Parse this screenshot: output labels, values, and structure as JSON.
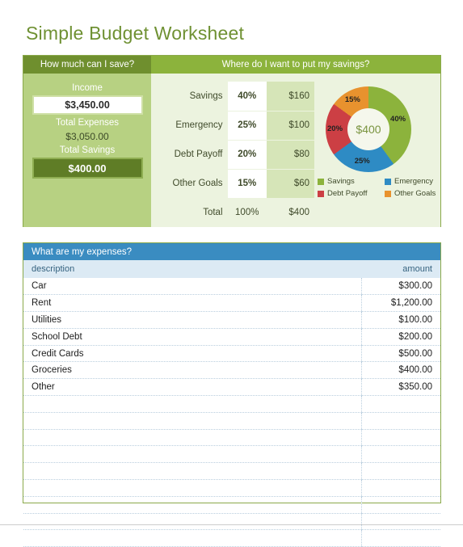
{
  "page_title": "Simple Budget Worksheet",
  "colors": {
    "title_green": "#6f9133",
    "header_dark_green": "#6f8f2e",
    "header_light_green": "#8cb33c",
    "panel_green": "#b7d182",
    "panel_pale_green": "#ecf3df",
    "savings_box_green": "#5f7d26",
    "expenses_blue": "#3a8cc1",
    "column_header_blue": "#dceaf4"
  },
  "savings": {
    "left_header": "How much can I save?",
    "right_header": "Where do I want to put my savings?",
    "income_label": "Income",
    "income_value": "$3,450.00",
    "total_expenses_label": "Total Expenses",
    "total_expenses_value": "$3,050.00",
    "total_savings_label": "Total Savings",
    "total_savings_value": "$400.00",
    "allocation_rows": [
      {
        "name": "Savings",
        "percent": "40%",
        "amount": "$160"
      },
      {
        "name": "Emergency",
        "percent": "25%",
        "amount": "$100"
      },
      {
        "name": "Debt Payoff",
        "percent": "20%",
        "amount": "$80"
      },
      {
        "name": "Other Goals",
        "percent": "15%",
        "amount": "$60"
      }
    ],
    "total_row": {
      "name": "Total",
      "percent": "100%",
      "amount": "$400"
    }
  },
  "chart_data": {
    "type": "pie",
    "title": "Where do I want to put my savings?",
    "center_label": "$400",
    "legend_position": "bottom",
    "categories": [
      "Savings",
      "Emergency",
      "Debt Payoff",
      "Other Goals"
    ],
    "values": [
      40,
      25,
      20,
      15
    ],
    "value_labels": [
      "40%",
      "25%",
      "20%",
      "15%"
    ],
    "amounts": [
      "$160",
      "$100",
      "$80",
      "$60"
    ],
    "colors": [
      "#8cb33c",
      "#2e8bc4",
      "#cc3f44",
      "#e8922e"
    ],
    "donut": true,
    "start_angle": 0
  },
  "expenses": {
    "header": "What are my expenses?",
    "columns": [
      "description",
      "amount"
    ],
    "rows": [
      {
        "description": "Car",
        "amount": "$300.00"
      },
      {
        "description": "Rent",
        "amount": "$1,200.00"
      },
      {
        "description": "Utilities",
        "amount": "$100.00"
      },
      {
        "description": "School Debt",
        "amount": "$200.00"
      },
      {
        "description": "Credit Cards",
        "amount": "$500.00"
      },
      {
        "description": "Groceries",
        "amount": "$400.00"
      },
      {
        "description": "Other",
        "amount": "$350.00"
      }
    ],
    "empty_row_count": 9
  }
}
